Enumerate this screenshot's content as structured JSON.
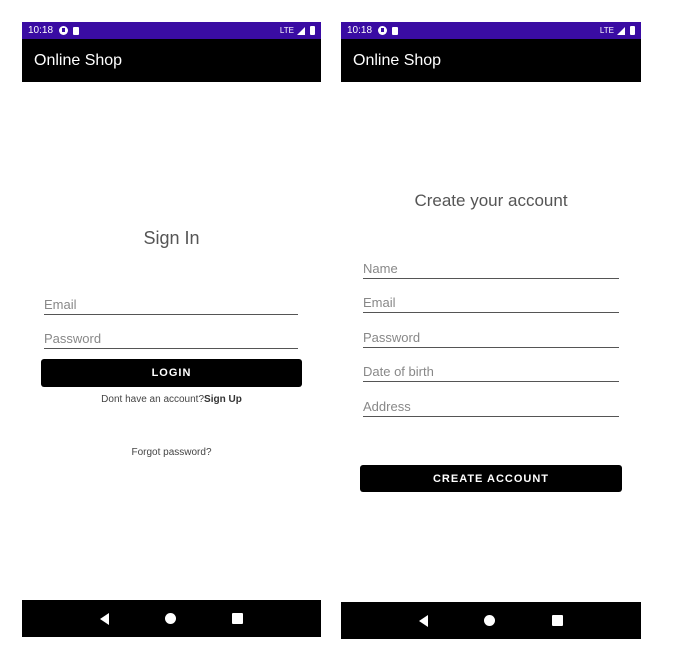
{
  "left_screen": {
    "status": {
      "time": "10:18",
      "network": "LTE"
    },
    "app_title": "Online Shop",
    "heading": "Sign In",
    "email_placeholder": "Email",
    "password_placeholder": "Password",
    "login_label": "LOGIN",
    "signup_prompt": "Dont have an account?",
    "signup_link": "Sign Up",
    "forgot_password": "Forgot password?"
  },
  "right_screen": {
    "status": {
      "time": "10:18",
      "network": "LTE"
    },
    "app_title": "Online Shop",
    "heading": "Create your account",
    "name_placeholder": "Name",
    "email_placeholder": "Email",
    "password_placeholder": "Password",
    "dob_placeholder": "Date of birth",
    "address_placeholder": "Address",
    "create_label": "CREATE ACCOUNT"
  },
  "colors": {
    "status_bar": "#3a0ca3",
    "app_bar": "#000000",
    "button": "#000000"
  },
  "icons": {
    "status": [
      "notification-circle-icon",
      "sd-card-icon",
      "signal-icon",
      "battery-icon"
    ],
    "navigation": [
      "back-icon",
      "home-icon",
      "recents-icon"
    ]
  }
}
